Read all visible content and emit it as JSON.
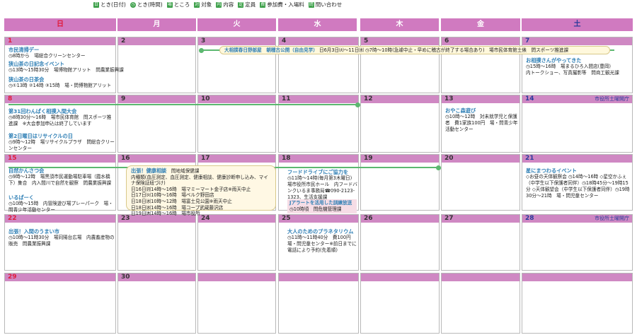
{
  "legend": [
    {
      "icon": "日",
      "label": "とき(日付)"
    },
    {
      "icon": "◷",
      "label": "とき(時間)"
    },
    {
      "icon": "場",
      "label": "ところ"
    },
    {
      "icon": "対",
      "label": "対象"
    },
    {
      "icon": "内",
      "label": "内容"
    },
    {
      "icon": "定",
      "label": "定員"
    },
    {
      "icon": "費",
      "label": "参加費・入場料"
    },
    {
      "icon": "問",
      "label": "問い合わせ"
    }
  ],
  "weekdays": [
    "日",
    "月",
    "火",
    "水",
    "木",
    "金",
    "土"
  ],
  "days": {
    "d1": "1",
    "d2": "2",
    "d3": "3",
    "d4": "4",
    "d5": "5",
    "d6": "6",
    "d7": "7",
    "d8": "8",
    "d9": "9",
    "d10": "10",
    "d11": "11",
    "d12": "12",
    "d13": "13",
    "d14": "14",
    "d15": "15",
    "d16": "16",
    "d17": "17",
    "d18": "18",
    "d19": "19",
    "d20": "20",
    "d21": "21",
    "d22": "22",
    "d23": "23",
    "d24": "24",
    "d25": "25",
    "d26": "26",
    "d27": "27",
    "d28": "28",
    "d29": "29",
    "d30": "30"
  },
  "notes": {
    "n14": "市役所土曜開庁",
    "n28": "市役所土曜開庁"
  },
  "events": {
    "e1a_t": "市民清掃デー",
    "e1a_1": "◷8時から　場総合クリーンセンター",
    "e1b_t": "狭山茶の日記念イベント",
    "e1b_1": "◷13時～15時30分　場博物館アリット　問農業振興課",
    "e1c_t": "狭山茶の日茶会",
    "e1c_1": "◷①13時 ②14時 ③15時　場・問博物館アリット",
    "band3": "大相撲春日野部屋　朝稽古公開（自由見学）",
    "band3_d": "日6月3日㈫～11日㈬ ◷7時～10時(急遽中止・早めに稽古が終了する場合あり)　場市民体育館土俵　問スポーツ推進課",
    "e7_t": "お相撲さんがやってきた",
    "e7_1": "◷15時～16時　場まるひろ入間店(豊岡)",
    "e7_2": "内トークショー、写真撮影等　問商工観光課",
    "e8a_t": "第31回わんぱく相撲入間大会",
    "e8a_1": "◷8時30分～16時　場市民体育館　問スポーツ推進課　※大会参加申込は終了しています",
    "e8b_t": "第2日曜日はリサイクルの日",
    "e8b_1": "◷9時～12時　場リサイクルプラザ　問総合クリーンセンター",
    "e13_t": "おやこ森遊び",
    "e13_1": "◷10時～12時　対未就学児と保護者　費1家族100円　場・問青少年活動センター",
    "e15a_t": "自然かんさつ会",
    "e15a_1": "◷9時～12時　場黒須市民運動場駐車場（霞水橋下）集合　内入間川で自然を観察　問農業振興課",
    "e15b_t": "いるぱーく",
    "e15b_1": "◷10時～15時　内冒険遊び場プレーパーク　場・問青少年活動センター",
    "c16_t": "出張！健康相談",
    "c16_p": "問地域保健課",
    "c16_1": "内種類(血圧測定、血圧測定、健康相談、健康診断申し込み、マイナ保険証紐づけ)",
    "c16_2": "日16日㈪14時～16時　場マミーマート金子店※雨天中止",
    "c16_3": "日17日㈫10時～16時　場ベルク野田店",
    "c16_4": "日18日㈬10時～12時　場富士見公園※雨天中止",
    "c16_5": "日18日㈬14時～16時　場コープ武蔵藤沢店",
    "c16_6": "日19日㈭14時～16時　場市役所",
    "e18_t": "フードドライブにご協力を",
    "e18_1": "◷11時～14時(毎月第3木曜日)　場市役所市民ホール　内フードバンクいるま事務局☎090-2123-1323、生活支援課",
    "alert_t": "Jアラートを活用した訓練放送",
    "alert_1": "◷10時頃　問危機管理課",
    "e21_t": "星にまつわるイベント",
    "e21_1": "◇お昼の天体観察会 ◷14時～16時 ◇星空かふぇ（中学生以下保護者同伴）◷18時45分～19時15分 ◇天体観望会（中学生以下保護者同伴）◷19時30分～21時　場・問児童センター",
    "e22_t": "出張！入間のうまい市",
    "e22_1": "◷10時～11時30分　場同陽台広場　内農畜産物の販売　問農業振興課",
    "e25_t": "大人のためのプラネタリウム",
    "e25_1": "◷11時～11時40分　費100円　場・問児童センター※前日までに電話により予約(先着順)"
  },
  "colors": {
    "header": "#d07ac0",
    "daybar": "#cf88c3",
    "sunday": "#e01b3c",
    "saturday": "#2a3a9a",
    "title": "#2f7fb5",
    "icon_green": "#3da04a",
    "line_green": "#5cb870"
  }
}
